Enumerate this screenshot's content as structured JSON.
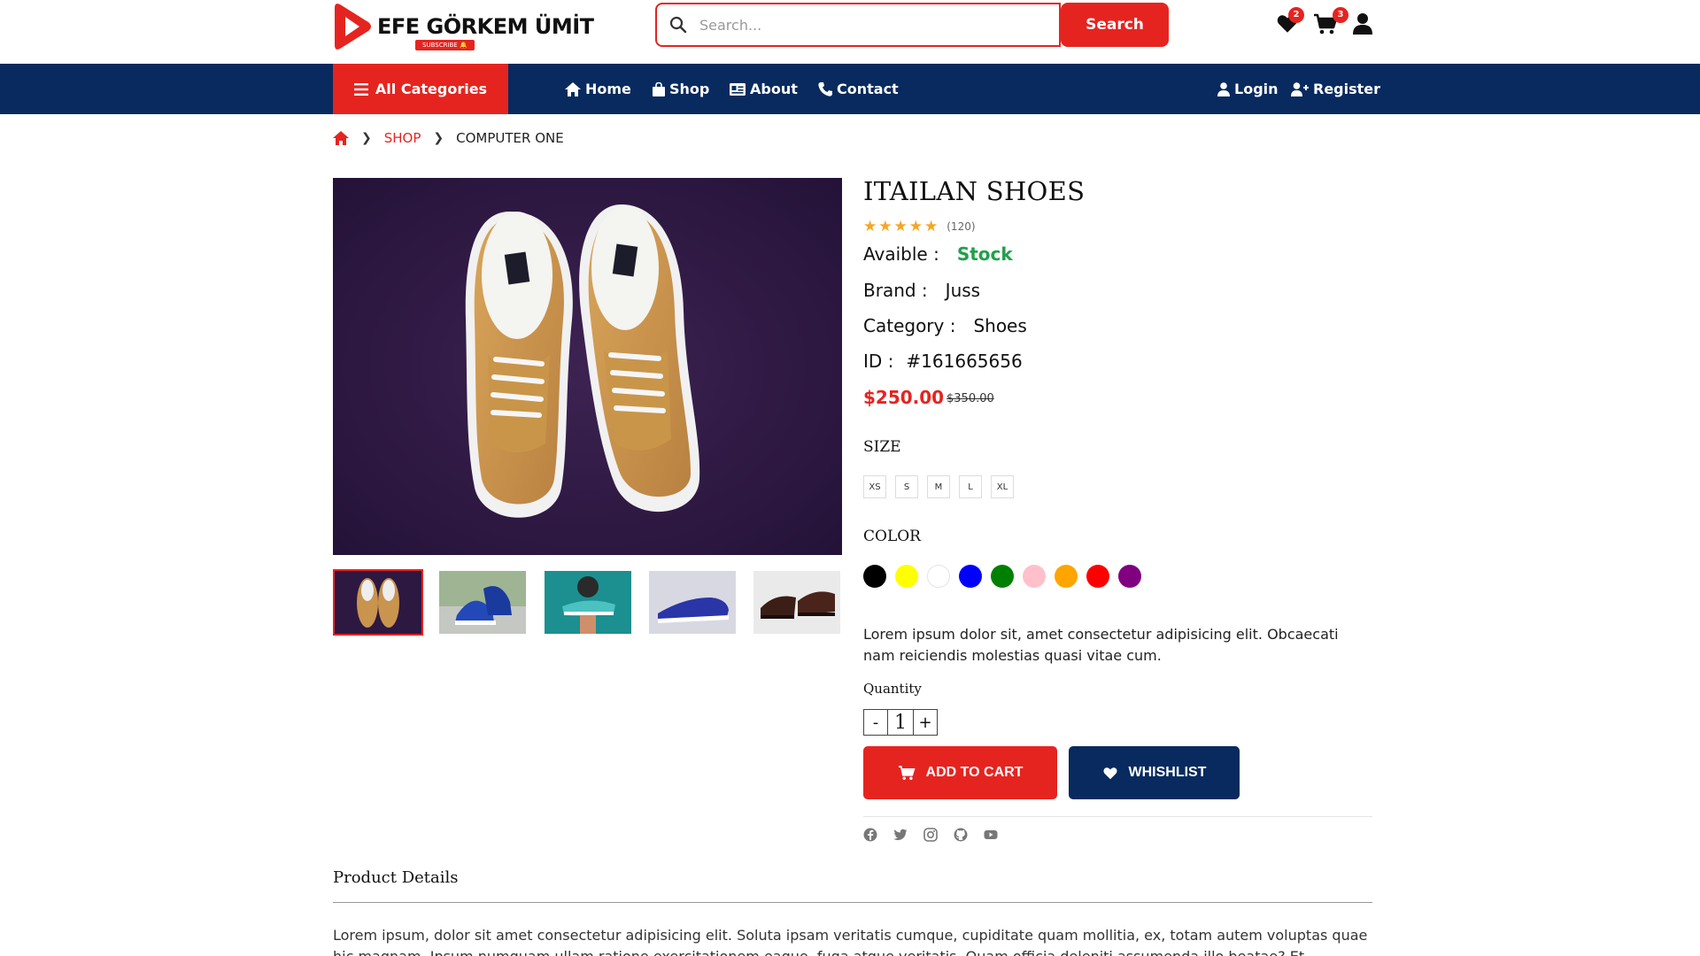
{
  "header": {
    "brand_name": "EFE GÖRKEM ÜMİT",
    "brand_sub": "SUBSCRIBE",
    "search_placeholder": "Search...",
    "search_button": "Search",
    "wishlist_count": "2",
    "cart_count": "3"
  },
  "nav": {
    "all_categories": "All Categories",
    "links": [
      {
        "label": "Home",
        "icon": "home-icon"
      },
      {
        "label": "Shop",
        "icon": "bag-icon"
      },
      {
        "label": "About",
        "icon": "id-card-icon"
      },
      {
        "label": "Contact",
        "icon": "phone-icon"
      }
    ],
    "login": "Login",
    "register": "Register"
  },
  "breadcrumb": {
    "shop": "SHOP",
    "current": "COMPUTER ONE"
  },
  "product": {
    "title": "ITAILAN SHOES",
    "rating": 5,
    "reviews": "(120)",
    "available_label": "Avaible :",
    "available_value": "Stock",
    "brand_label": "Brand :",
    "brand_value": "Juss",
    "category_label": "Category :",
    "category_value": "Shoes",
    "id_label": "ID :",
    "id_value": "#161665656",
    "price": "$250.00",
    "old_price": "$350.00",
    "size_label": "SIZE",
    "sizes": [
      "XS",
      "S",
      "M",
      "L",
      "XL"
    ],
    "color_label": "COLOR",
    "colors": [
      "#000000",
      "#ffff00",
      "#ffffff",
      "#0000ff",
      "#008000",
      "#ffc0cb",
      "#ffa500",
      "#ff0000",
      "#800080"
    ],
    "description": "Lorem ipsum dolor sit, amet consectetur adipisicing elit. Obcaecati nam reiciendis molestias quasi vitae cum.",
    "quantity_label": "Quantity",
    "quantity": "1",
    "qty_minus": "-",
    "qty_plus": "+",
    "add_to_cart": "ADD TO CART",
    "wishlist": "WHISHLIST"
  },
  "socials": [
    "facebook-icon",
    "twitter-icon",
    "instagram-icon",
    "github-icon",
    "youtube-icon"
  ],
  "details": {
    "title": "Product Details",
    "text": "Lorem ipsum, dolor sit amet consectetur adipisicing elit. Soluta ipsam veritatis cumque, cupiditate quam mollitia, ex, totam autem voluptas quae hic magnam. Ipsum numquam ullam ratione exercitationem eaque, fuga atque veritatis. Quam officia deleniti assumenda illo beatae? Et"
  },
  "colors": {
    "accent": "#e52420",
    "navy": "#082a5e",
    "stock": "#21a04a"
  }
}
